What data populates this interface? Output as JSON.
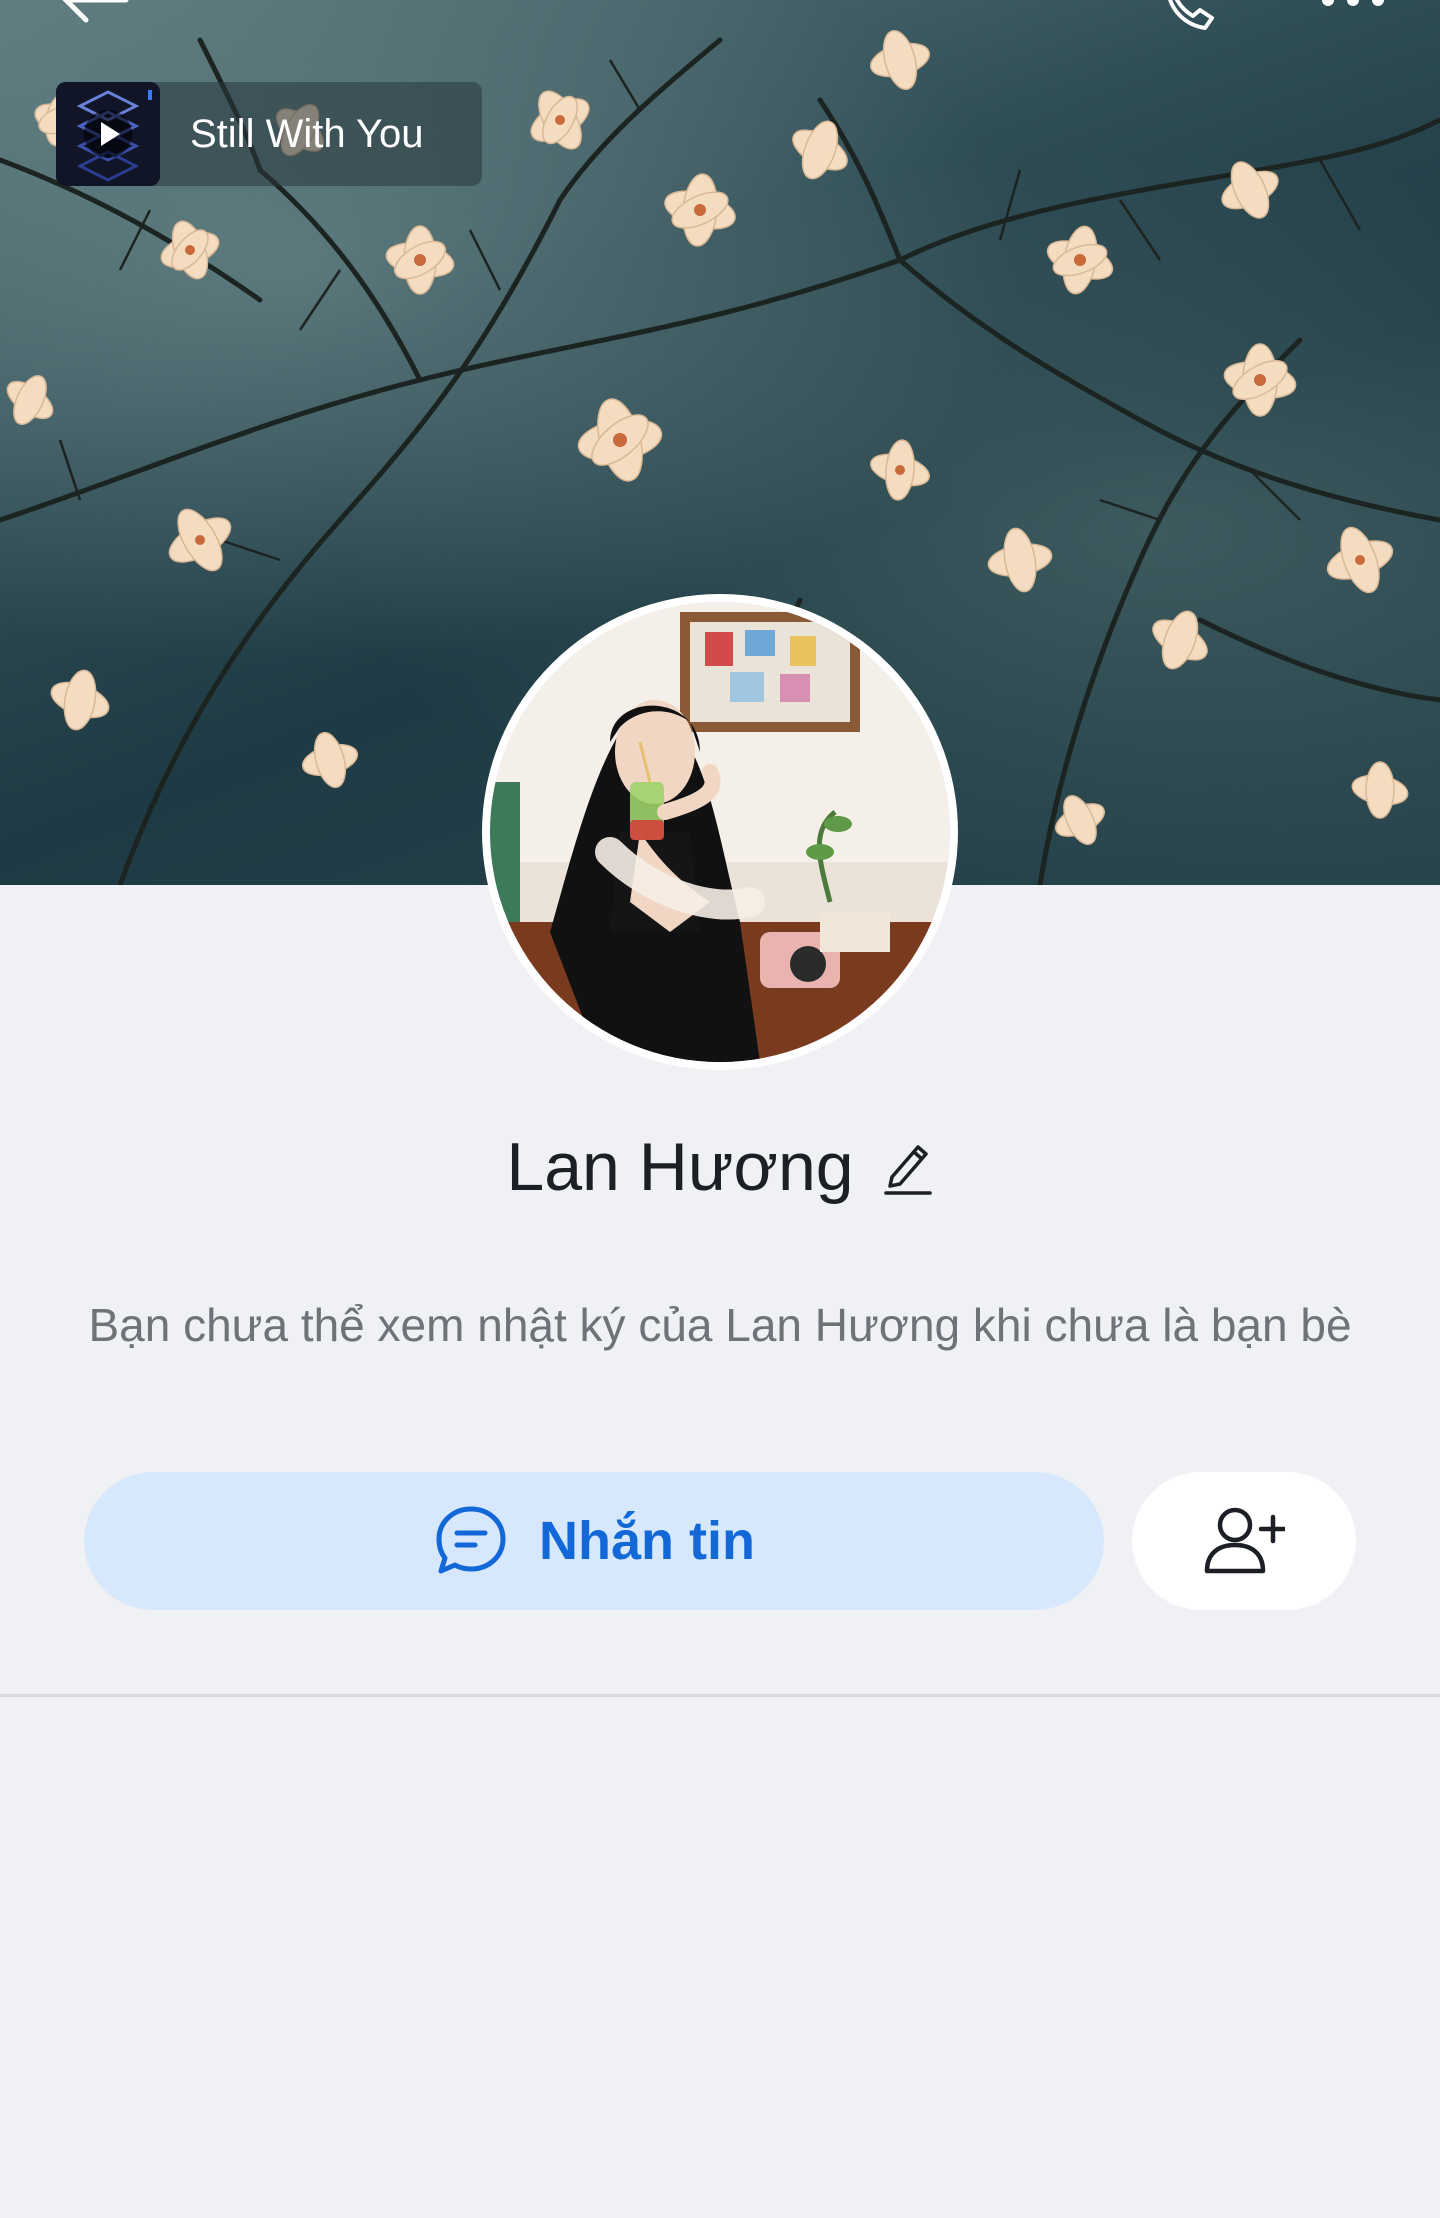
{
  "header": {
    "back_icon": "arrow-left-icon",
    "call_icon": "phone-icon",
    "more_icon": "more-horizontal-icon"
  },
  "music": {
    "song_title": "Still With You",
    "icon": "play-icon"
  },
  "profile": {
    "name": "Lan Hương",
    "edit_icon": "pencil-icon",
    "notice": "Bạn chưa thể xem nhật ký của Lan Hương khi chưa là bạn bè"
  },
  "actions": {
    "message_label": "Nhắn tin",
    "message_icon": "chat-bubble-icon",
    "add_friend_icon": "user-plus-icon"
  },
  "colors": {
    "primary": "#1268d6",
    "primary_light": "#d7e8fc",
    "background": "#f0f1f5",
    "text": "#1c1f25",
    "muted": "#6e737a"
  }
}
